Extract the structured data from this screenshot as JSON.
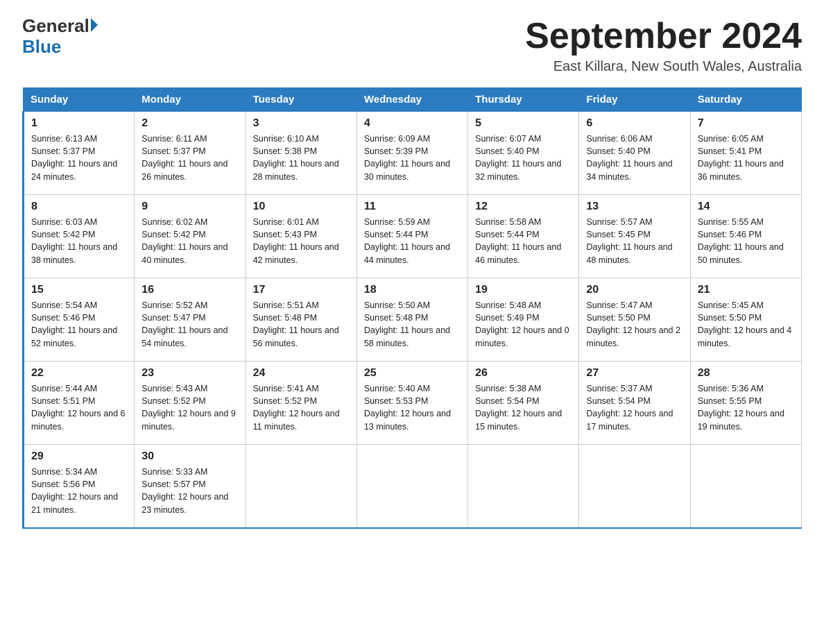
{
  "header": {
    "logo_general": "General",
    "logo_blue": "Blue",
    "title": "September 2024",
    "subtitle": "East Killara, New South Wales, Australia"
  },
  "days_of_week": [
    "Sunday",
    "Monday",
    "Tuesday",
    "Wednesday",
    "Thursday",
    "Friday",
    "Saturday"
  ],
  "weeks": [
    [
      {
        "day": "1",
        "sunrise": "6:13 AM",
        "sunset": "5:37 PM",
        "daylight": "11 hours and 24 minutes."
      },
      {
        "day": "2",
        "sunrise": "6:11 AM",
        "sunset": "5:37 PM",
        "daylight": "11 hours and 26 minutes."
      },
      {
        "day": "3",
        "sunrise": "6:10 AM",
        "sunset": "5:38 PM",
        "daylight": "11 hours and 28 minutes."
      },
      {
        "day": "4",
        "sunrise": "6:09 AM",
        "sunset": "5:39 PM",
        "daylight": "11 hours and 30 minutes."
      },
      {
        "day": "5",
        "sunrise": "6:07 AM",
        "sunset": "5:40 PM",
        "daylight": "11 hours and 32 minutes."
      },
      {
        "day": "6",
        "sunrise": "6:06 AM",
        "sunset": "5:40 PM",
        "daylight": "11 hours and 34 minutes."
      },
      {
        "day": "7",
        "sunrise": "6:05 AM",
        "sunset": "5:41 PM",
        "daylight": "11 hours and 36 minutes."
      }
    ],
    [
      {
        "day": "8",
        "sunrise": "6:03 AM",
        "sunset": "5:42 PM",
        "daylight": "11 hours and 38 minutes."
      },
      {
        "day": "9",
        "sunrise": "6:02 AM",
        "sunset": "5:42 PM",
        "daylight": "11 hours and 40 minutes."
      },
      {
        "day": "10",
        "sunrise": "6:01 AM",
        "sunset": "5:43 PM",
        "daylight": "11 hours and 42 minutes."
      },
      {
        "day": "11",
        "sunrise": "5:59 AM",
        "sunset": "5:44 PM",
        "daylight": "11 hours and 44 minutes."
      },
      {
        "day": "12",
        "sunrise": "5:58 AM",
        "sunset": "5:44 PM",
        "daylight": "11 hours and 46 minutes."
      },
      {
        "day": "13",
        "sunrise": "5:57 AM",
        "sunset": "5:45 PM",
        "daylight": "11 hours and 48 minutes."
      },
      {
        "day": "14",
        "sunrise": "5:55 AM",
        "sunset": "5:46 PM",
        "daylight": "11 hours and 50 minutes."
      }
    ],
    [
      {
        "day": "15",
        "sunrise": "5:54 AM",
        "sunset": "5:46 PM",
        "daylight": "11 hours and 52 minutes."
      },
      {
        "day": "16",
        "sunrise": "5:52 AM",
        "sunset": "5:47 PM",
        "daylight": "11 hours and 54 minutes."
      },
      {
        "day": "17",
        "sunrise": "5:51 AM",
        "sunset": "5:48 PM",
        "daylight": "11 hours and 56 minutes."
      },
      {
        "day": "18",
        "sunrise": "5:50 AM",
        "sunset": "5:48 PM",
        "daylight": "11 hours and 58 minutes."
      },
      {
        "day": "19",
        "sunrise": "5:48 AM",
        "sunset": "5:49 PM",
        "daylight": "12 hours and 0 minutes."
      },
      {
        "day": "20",
        "sunrise": "5:47 AM",
        "sunset": "5:50 PM",
        "daylight": "12 hours and 2 minutes."
      },
      {
        "day": "21",
        "sunrise": "5:45 AM",
        "sunset": "5:50 PM",
        "daylight": "12 hours and 4 minutes."
      }
    ],
    [
      {
        "day": "22",
        "sunrise": "5:44 AM",
        "sunset": "5:51 PM",
        "daylight": "12 hours and 6 minutes."
      },
      {
        "day": "23",
        "sunrise": "5:43 AM",
        "sunset": "5:52 PM",
        "daylight": "12 hours and 9 minutes."
      },
      {
        "day": "24",
        "sunrise": "5:41 AM",
        "sunset": "5:52 PM",
        "daylight": "12 hours and 11 minutes."
      },
      {
        "day": "25",
        "sunrise": "5:40 AM",
        "sunset": "5:53 PM",
        "daylight": "12 hours and 13 minutes."
      },
      {
        "day": "26",
        "sunrise": "5:38 AM",
        "sunset": "5:54 PM",
        "daylight": "12 hours and 15 minutes."
      },
      {
        "day": "27",
        "sunrise": "5:37 AM",
        "sunset": "5:54 PM",
        "daylight": "12 hours and 17 minutes."
      },
      {
        "day": "28",
        "sunrise": "5:36 AM",
        "sunset": "5:55 PM",
        "daylight": "12 hours and 19 minutes."
      }
    ],
    [
      {
        "day": "29",
        "sunrise": "5:34 AM",
        "sunset": "5:56 PM",
        "daylight": "12 hours and 21 minutes."
      },
      {
        "day": "30",
        "sunrise": "5:33 AM",
        "sunset": "5:57 PM",
        "daylight": "12 hours and 23 minutes."
      },
      null,
      null,
      null,
      null,
      null
    ]
  ],
  "labels": {
    "sunrise": "Sunrise:",
    "sunset": "Sunset:",
    "daylight": "Daylight:"
  }
}
